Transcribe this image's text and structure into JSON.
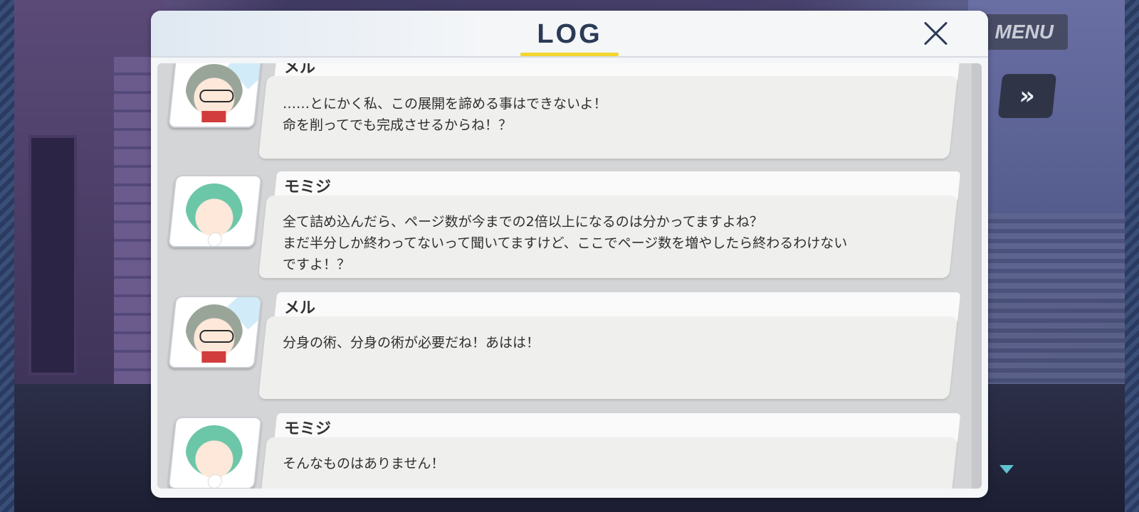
{
  "hud": {
    "menu_label": "MENU",
    "fast_forward_icon": "»"
  },
  "log": {
    "title": "LOG",
    "entries": [
      {
        "speaker": "メル",
        "avatar": "mel",
        "lines": [
          "……とにかく私、この展開を諦める事はできないよ！",
          "命を削ってでも完成させるからね！？"
        ]
      },
      {
        "speaker": "モミジ",
        "avatar": "momiji",
        "lines": [
          "全て詰め込んだら、ページ数が今までの2倍以上になるのは分かってますよね？",
          "まだ半分しか終わってないって聞いてますけど、ここでページ数を増やしたら終わるわけない",
          "ですよ！？"
        ]
      },
      {
        "speaker": "メル",
        "avatar": "mel",
        "lines": [
          "分身の術、分身の術が必要だね！あはは！"
        ]
      },
      {
        "speaker": "モミジ",
        "avatar": "momiji",
        "lines": [
          "そんなものはありません！"
        ]
      }
    ]
  }
}
